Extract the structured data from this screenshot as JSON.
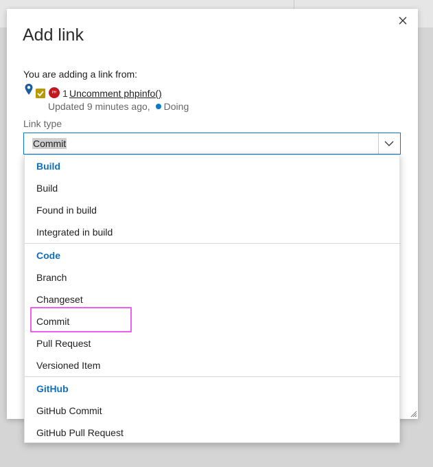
{
  "dialog": {
    "title": "Add link",
    "from_label": "You are adding a link from:",
    "work_item": {
      "id": "1",
      "title": "Uncomment phpinfo()",
      "avatar_initials": "PH",
      "updated": "Updated 9 minutes ago,",
      "state": "Doing",
      "state_color": "#007acc",
      "type_color": "#b89a00",
      "icons": [
        "map-pin-icon",
        "checkbox-icon",
        "avatar"
      ]
    },
    "link_type_label": "Link type",
    "link_type_value": "Commit",
    "close_icon": "close-icon",
    "chevron_icon": "chevron-down-icon"
  },
  "dropdown": {
    "groups": [
      {
        "header": "Build",
        "options": [
          "Build",
          "Found in build",
          "Integrated in build"
        ]
      },
      {
        "header": "Code",
        "options": [
          "Branch",
          "Changeset",
          "Commit",
          "Pull Request",
          "Versioned Item"
        ]
      },
      {
        "header": "GitHub",
        "options": [
          "GitHub Commit",
          "GitHub Pull Request"
        ]
      }
    ],
    "highlighted_option": "Commit",
    "header_color": "#106ebe",
    "highlight_color": "#ee5cf0"
  }
}
